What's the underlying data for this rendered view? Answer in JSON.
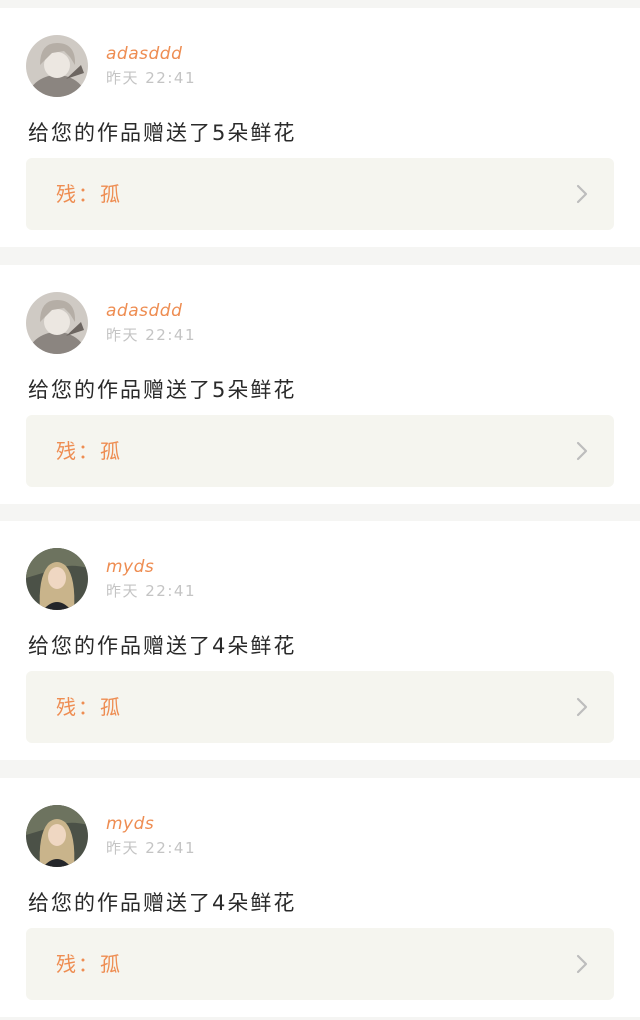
{
  "notifications": [
    {
      "username": "adasddd",
      "time": "昨天  22:41",
      "message": "给您的作品赠送了5朵鲜花",
      "work_title": "残：孤",
      "avatar_icon": "anime-character-avatar"
    },
    {
      "username": "adasddd",
      "time": "昨天  22:41",
      "message": "给您的作品赠送了5朵鲜花",
      "work_title": "残：孤",
      "avatar_icon": "anime-character-avatar"
    },
    {
      "username": "myds",
      "time": "昨天  22:41",
      "message": "给您的作品赠送了4朵鲜花",
      "work_title": "残：孤",
      "avatar_icon": "blonde-woman-avatar"
    },
    {
      "username": "myds",
      "time": "昨天  22:41",
      "message": "给您的作品赠送了4朵鲜花",
      "work_title": "残：孤",
      "avatar_icon": "blonde-woman-avatar"
    }
  ],
  "colors": {
    "accent": "#ee8d52",
    "timestamp": "#c4c4c4",
    "message": "#2a2a2a",
    "card_bg": "#ffffff",
    "link_bg": "#f5f5ef",
    "page_bg": "#f5f5f3"
  },
  "icons": {
    "chevron": "chevron-right-icon"
  }
}
